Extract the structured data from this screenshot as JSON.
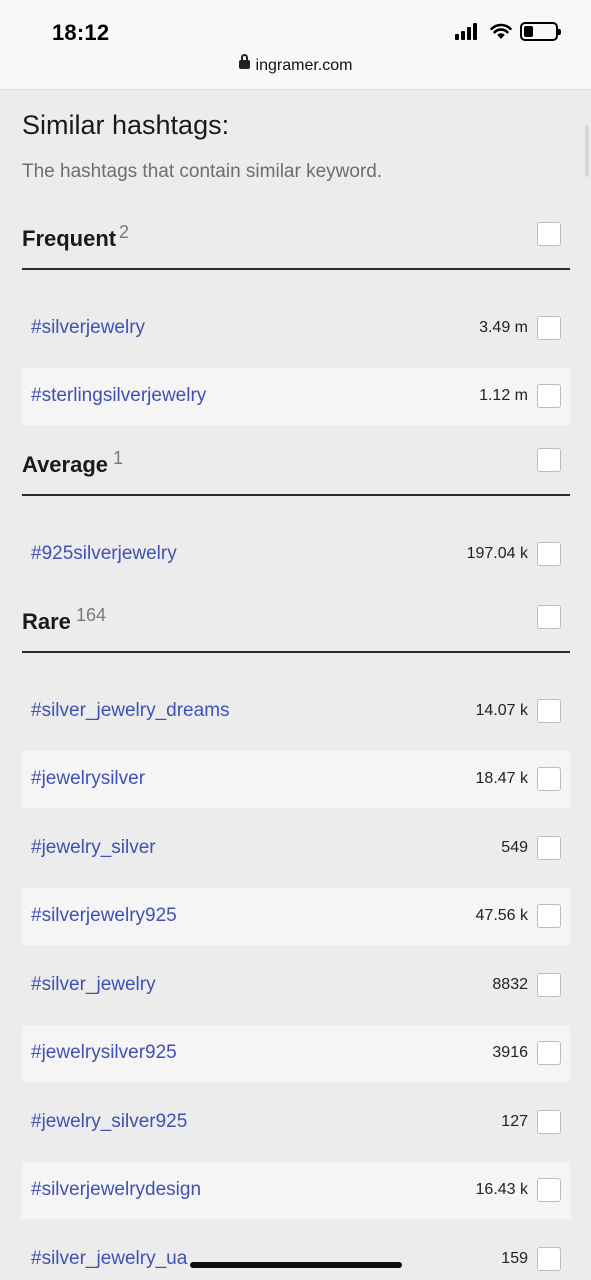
{
  "status_bar": {
    "time": "18:12",
    "url": "ingramer.com"
  },
  "heading": {
    "title": "Similar hashtags:",
    "subtitle": "The hashtags that contain similar keyword."
  },
  "groups": [
    {
      "name": "Frequent",
      "count": "2",
      "items": [
        {
          "tag": "#silverjewelry",
          "value": "3.49 m"
        },
        {
          "tag": "#sterlingsilverjewelry",
          "value": "1.12 m"
        }
      ]
    },
    {
      "name": "Average",
      "count": "1",
      "items": [
        {
          "tag": "#925silverjewelry",
          "value": "197.04 k"
        }
      ]
    },
    {
      "name": "Rare",
      "count": "164",
      "items": [
        {
          "tag": "#silver_jewelry_dreams",
          "value": "14.07 k"
        },
        {
          "tag": "#jewelrysilver",
          "value": "18.47 k"
        },
        {
          "tag": "#jewelry_silver",
          "value": "549"
        },
        {
          "tag": "#silverjewelry925",
          "value": "47.56 k"
        },
        {
          "tag": "#silver_jewelry",
          "value": "8832"
        },
        {
          "tag": "#jewelrysilver925",
          "value": "3916"
        },
        {
          "tag": "#jewelry_silver925",
          "value": "127"
        },
        {
          "tag": "#silverjewelrydesign",
          "value": "16.43 k"
        },
        {
          "tag": "#silver_jewelry_ua",
          "value": "159"
        }
      ]
    }
  ]
}
